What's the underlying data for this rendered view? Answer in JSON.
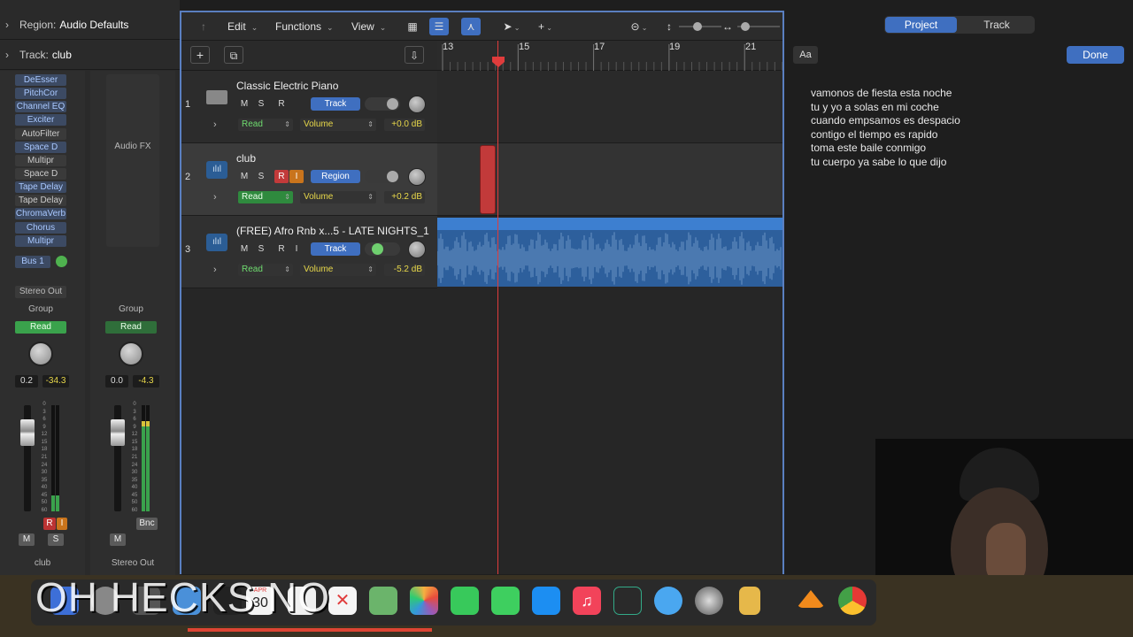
{
  "inspector": {
    "region_label": "Region:",
    "region_value": "Audio Defaults",
    "track_label": "Track:",
    "track_value": "club",
    "plugins": [
      "DeEsser",
      "PitchCor",
      "Channel EQ",
      "Exciter",
      "AutoFilter",
      "Space D",
      "Multipr",
      "Space D",
      "Tape Delay",
      "Tape Delay",
      "ChromaVerb",
      "Chorus",
      "Multipr"
    ],
    "audio_fx": "Audio FX",
    "bus": "Bus 1",
    "output1": "Stereo Out",
    "group1": "Group",
    "group2": "Group",
    "read1": "Read",
    "read2": "Read",
    "pan1": "0.2",
    "vol1": "-34.3",
    "pan2": "0.0",
    "vol2": "-4.3",
    "rec": "R",
    "inp": "I",
    "m1": "M",
    "s1": "S",
    "m2": "M",
    "bnc": "Bnc",
    "name1": "club",
    "name2": "Stereo Out",
    "scale": [
      "0",
      "3",
      "6",
      "9",
      "12",
      "15",
      "18",
      "21",
      "24",
      "30",
      "35",
      "40",
      "45",
      "50",
      "60"
    ]
  },
  "toolbar": {
    "edit": "Edit",
    "functions": "Functions",
    "view": "View"
  },
  "ruler": {
    "marks": [
      "13",
      "15",
      "17",
      "19",
      "21"
    ]
  },
  "tracks": [
    {
      "num": "1",
      "name": "Classic Electric Piano",
      "m": "M",
      "s": "S",
      "r": "R",
      "mode": "Track",
      "auto": "Read",
      "param": "Volume",
      "db": "+0.0 dB"
    },
    {
      "num": "2",
      "name": "club",
      "m": "M",
      "s": "S",
      "r": "R",
      "i": "I",
      "mode": "Region",
      "auto": "Read",
      "param": "Volume",
      "db": "+0.2 dB"
    },
    {
      "num": "3",
      "name": "(FREE) Afro Rnb x...5 - LATE NIGHTS_1",
      "m": "M",
      "s": "S",
      "r": "R",
      "i": "I",
      "mode": "Track",
      "auto": "Read",
      "param": "Volume",
      "db": "-5.2 dB"
    }
  ],
  "lyrics": {
    "tab_project": "Project",
    "tab_track": "Track",
    "aa": "Aa",
    "done": "Done",
    "lines": [
      "vamonos de fiesta esta noche",
      "tu y yo a solas en mi coche",
      "cuando empsamos es despacio",
      "contigo el tiempo es rapido",
      "toma este baile conmigo",
      "tu cuerpo ya sabe lo que dijo"
    ]
  },
  "overlay_text": "OH HECKS NO",
  "dock": {
    "calendar_month": "APR",
    "calendar_day": "30"
  }
}
